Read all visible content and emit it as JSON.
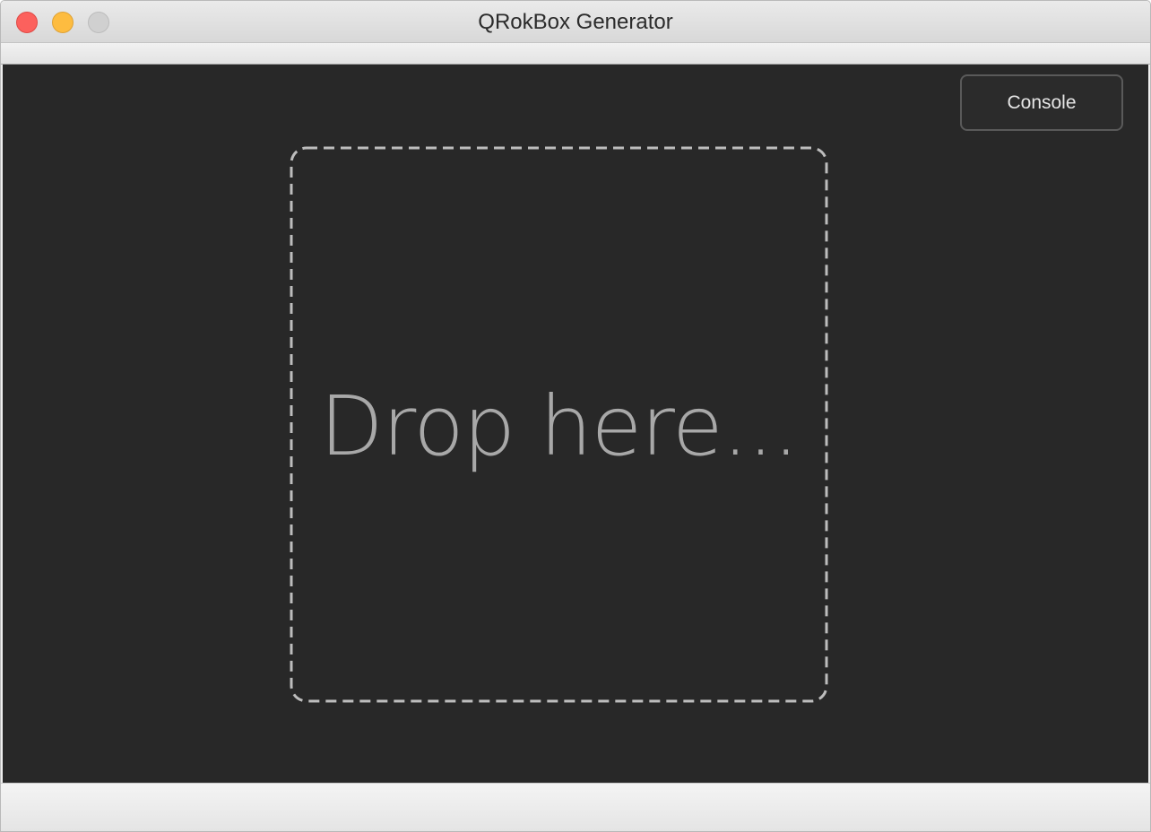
{
  "window": {
    "title": "QRokBox Generator"
  },
  "toolbar": {
    "console_label": "Console"
  },
  "dropzone": {
    "label": "Drop here..."
  },
  "colors": {
    "background": "#282828",
    "dropzone_border": "#bdbdbd",
    "drop_text": "#a8a8a8",
    "close": "#fc615d",
    "minimize": "#fdbc40",
    "zoom_disabled": "#d0d0d0"
  }
}
